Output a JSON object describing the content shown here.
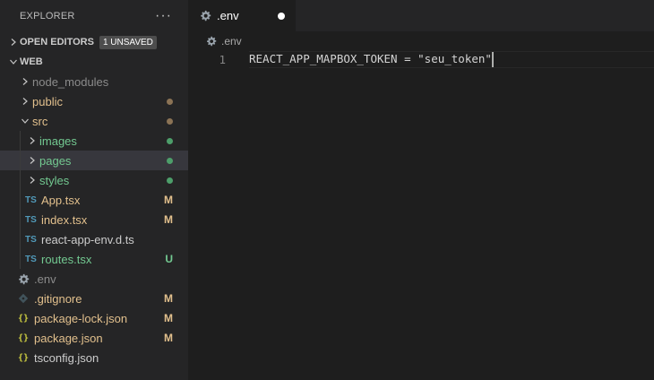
{
  "sidebar": {
    "title": "EXPLORER",
    "more_label": "···",
    "open_editors": {
      "label": "OPEN EDITORS",
      "badge": "1 UNSAVED"
    },
    "workspace": {
      "label": "WEB"
    },
    "tree": [
      {
        "name": "node_modules",
        "kind": "folder",
        "depth": 1,
        "color": "#8b8b8b",
        "expanded": false
      },
      {
        "name": "public",
        "kind": "folder",
        "depth": 1,
        "color": "#e2c08d",
        "status_dot": "#8b7355",
        "expanded": false
      },
      {
        "name": "src",
        "kind": "folder",
        "depth": 1,
        "color": "#e2c08d",
        "status_dot": "#8b7355",
        "expanded": true
      },
      {
        "name": "images",
        "kind": "folder",
        "depth": 2,
        "color": "#73c991",
        "status_dot": "#4d9e6a",
        "expanded": false
      },
      {
        "name": "pages",
        "kind": "folder",
        "depth": 2,
        "color": "#73c991",
        "status_dot": "#4d9e6a",
        "expanded": false,
        "selected": true
      },
      {
        "name": "styles",
        "kind": "folder",
        "depth": 2,
        "color": "#73c991",
        "status_dot": "#4d9e6a",
        "expanded": false
      },
      {
        "name": "App.tsx",
        "kind": "ts",
        "icon": "TS",
        "depth": 2,
        "color": "#e2c08d",
        "decoration": "M"
      },
      {
        "name": "index.tsx",
        "kind": "ts",
        "icon": "TS",
        "depth": 2,
        "color": "#e2c08d",
        "decoration": "M"
      },
      {
        "name": "react-app-env.d.ts",
        "kind": "ts",
        "icon": "TS",
        "depth": 2,
        "color": "#cccccc"
      },
      {
        "name": "routes.tsx",
        "kind": "ts",
        "icon": "TS",
        "depth": 2,
        "color": "#73c991",
        "decoration": "U"
      },
      {
        "name": ".env",
        "kind": "gear",
        "depth": 1,
        "color": "#8b8b8b"
      },
      {
        "name": ".gitignore",
        "kind": "git",
        "depth": 1,
        "color": "#e2c08d",
        "decoration": "M"
      },
      {
        "name": "package-lock.json",
        "kind": "json",
        "icon": "{}",
        "depth": 1,
        "color": "#e2c08d",
        "decoration": "M"
      },
      {
        "name": "package.json",
        "kind": "json",
        "icon": "{}",
        "depth": 1,
        "color": "#e2c08d",
        "decoration": "M"
      },
      {
        "name": "tsconfig.json",
        "kind": "json",
        "icon": "{}",
        "depth": 1,
        "color": "#cccccc"
      }
    ]
  },
  "editor": {
    "tab": {
      "label": ".env",
      "dirty": true
    },
    "breadcrumb": ".env",
    "lines": [
      {
        "number": "1",
        "text": "REACT_APP_MAPBOX_TOKEN = \"seu_token\""
      }
    ]
  },
  "colors": {
    "editor_bg": "#1e1e1e",
    "sidebar_bg": "#252526",
    "selection_bg": "#37373d",
    "modified": "#e2c08d",
    "untracked": "#73c991",
    "ignored": "#8b8b8b"
  }
}
